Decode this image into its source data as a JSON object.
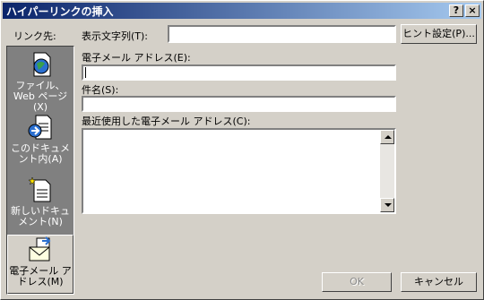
{
  "title": "ハイパーリンクの挿入",
  "title_buttons": {
    "help": "?",
    "close": "×"
  },
  "link_to_label": "リンク先:",
  "display_text": {
    "label": "表示文字列(T):",
    "value": ""
  },
  "screen_tip_button": "ヒント設定(P)...",
  "email_address": {
    "label": "電子メール アドレス(E):",
    "value": ""
  },
  "subject": {
    "label": "件名(S):",
    "value": ""
  },
  "recent_addresses": {
    "label": "最近使用した電子メール アドレス(C):",
    "items": []
  },
  "sidebar": {
    "items": [
      {
        "label": "ファイル、Web ページ(X)",
        "icon": "web-page-icon",
        "active": false
      },
      {
        "label": "このドキュメント内(A)",
        "icon": "this-document-icon",
        "active": false
      },
      {
        "label": "新しいドキュメント(N)",
        "icon": "new-document-icon",
        "active": false
      },
      {
        "label": "電子メール アドレス(M)",
        "icon": "email-address-icon",
        "active": true
      }
    ]
  },
  "ok_button": "OK",
  "cancel_button": "キャンセル"
}
